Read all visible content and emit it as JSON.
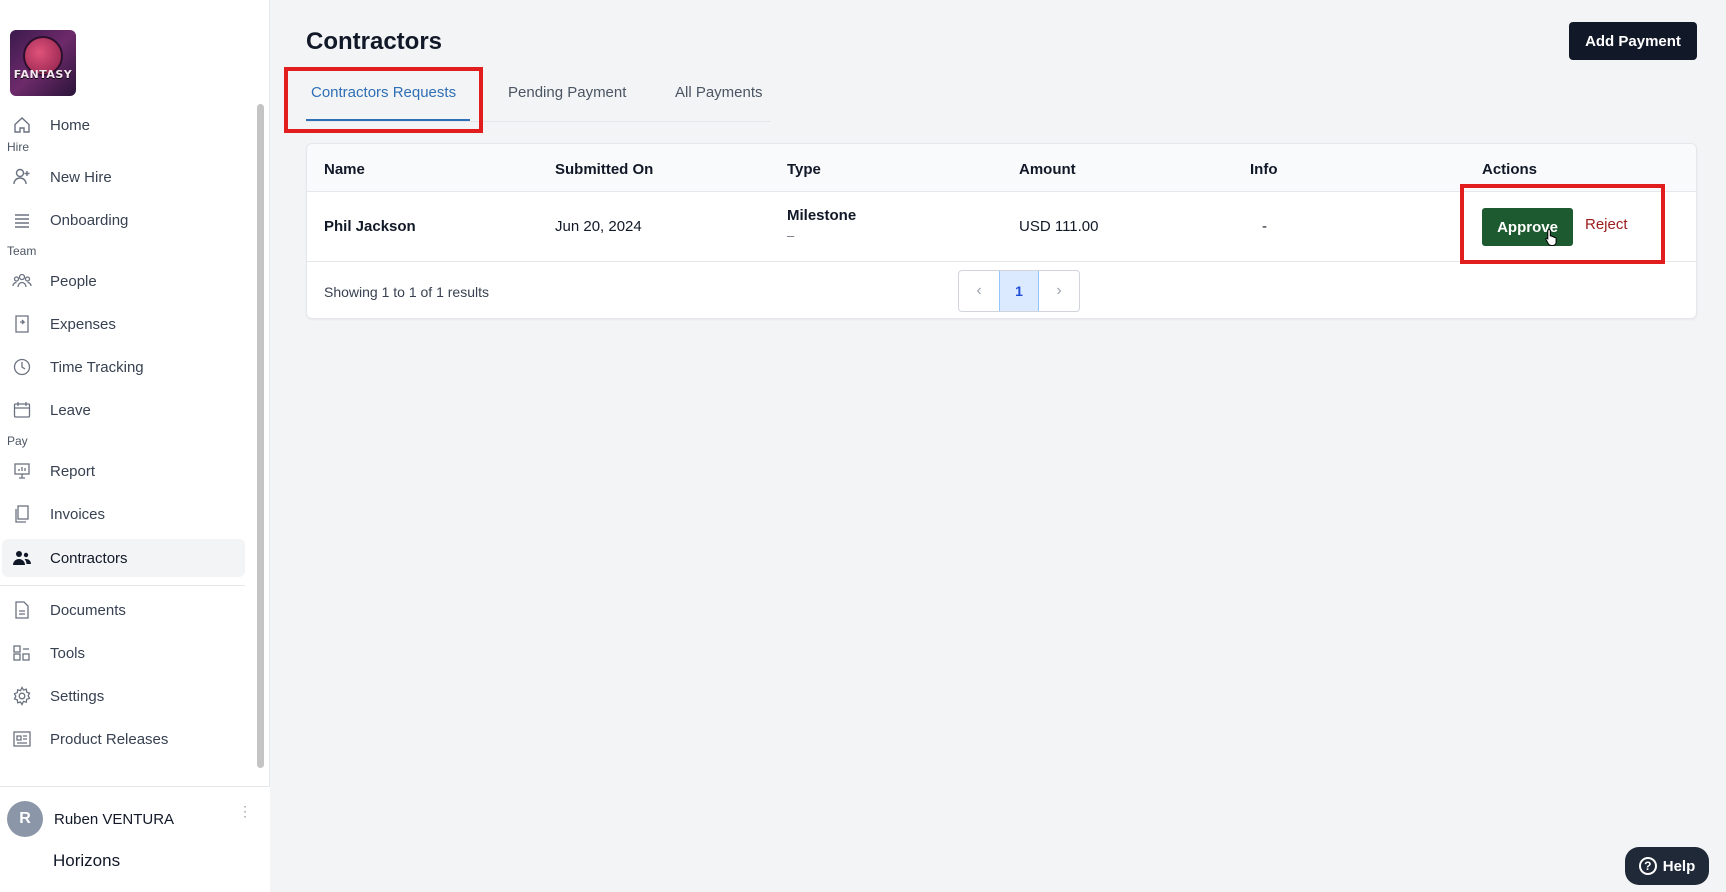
{
  "sidebar": {
    "logo_text": "FANTASY",
    "sections": {
      "hire": "Hire",
      "team": "Team",
      "pay": "Pay"
    },
    "items": {
      "home": "Home",
      "new_hire": "New Hire",
      "onboarding": "Onboarding",
      "people": "People",
      "expenses": "Expenses",
      "time_tracking": "Time Tracking",
      "leave": "Leave",
      "report": "Report",
      "invoices": "Invoices",
      "contractors": "Contractors",
      "documents": "Documents",
      "tools": "Tools",
      "settings": "Settings",
      "product_releases": "Product Releases"
    },
    "user": {
      "initial": "R",
      "name": "Ruben VENTURA",
      "menu": "⋮"
    },
    "org": "Horizons"
  },
  "header": {
    "title": "Contractors",
    "add_payment": "Add Payment"
  },
  "tabs": [
    {
      "label": "Contractors Requests",
      "active": true
    },
    {
      "label": "Pending Payment",
      "active": false
    },
    {
      "label": "All Payments",
      "active": false
    }
  ],
  "table": {
    "columns": [
      "Name",
      "Submitted On",
      "Type",
      "Amount",
      "Info",
      "Actions"
    ],
    "rows": [
      {
        "name": "Phil Jackson",
        "submitted_on": "Jun 20, 2024",
        "type": "Milestone",
        "type_sub": "–",
        "amount": "USD 111.00",
        "info": "-",
        "approve": "Approve",
        "reject": "Reject"
      }
    ],
    "footer": "Showing 1 to 1 of 1 results",
    "pager": {
      "prev": "‹",
      "current": "1",
      "next": "›"
    }
  },
  "help": {
    "icon": "?",
    "label": "Help"
  },
  "colors": {
    "accent": "#2f6fb5",
    "approve": "#1e5a30",
    "reject": "#9b1c1c",
    "highlight": "#e11d1d",
    "dark": "#111827"
  }
}
